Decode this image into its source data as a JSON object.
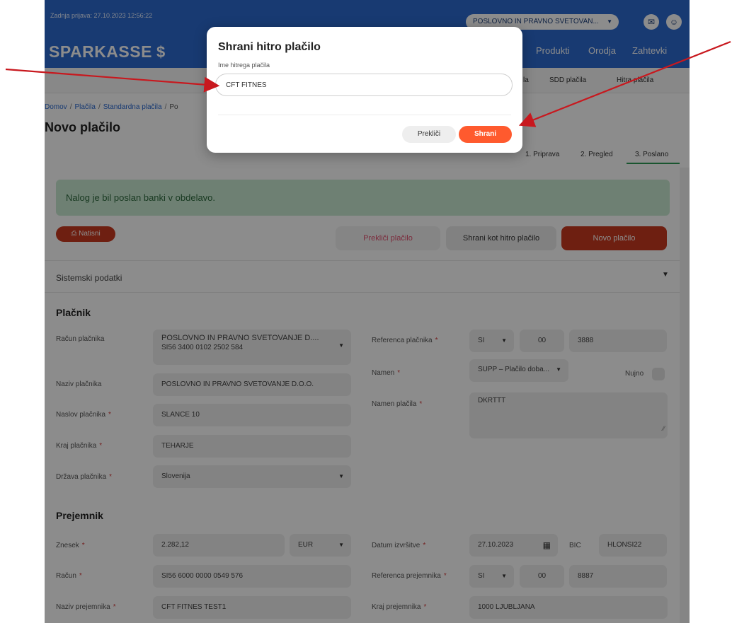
{
  "header": {
    "last_login": "Zadnja prijava: 27.10.2023 12:56:22",
    "company_select": "POSLOVNO IN PRAVNO SVETOVAN...",
    "logo": "SPARKASSE",
    "nav": [
      "Produkti",
      "Orodja",
      "Zahtevki"
    ],
    "subnav": [
      "la",
      "SDD plačila",
      "Hitra plačila"
    ]
  },
  "breadcrumb": [
    "Domov",
    "Plačila",
    "Standardna plačila",
    "Po"
  ],
  "page_title": "Novo plačilo",
  "steps": [
    "1. Priprava",
    "2. Pregled",
    "3. Poslano"
  ],
  "success_message": "Nalog je bil poslan banki v obdelavo.",
  "actions": {
    "print": "Natisni",
    "cancel_payment": "Prekliči plačilo",
    "save_fast": "Shrani kot hitro plačilo",
    "new_payment": "Novo plačilo"
  },
  "system_data_label": "Sistemski podatki",
  "payer": {
    "section_title": "Plačnik",
    "account_label": "Račun plačnika",
    "account_name": "POSLOVNO IN PRAVNO SVETOVANJE D....",
    "account_iban": "SI56 3400 0102 2502 584",
    "name_label": "Naziv plačnika",
    "name_value": "POSLOVNO IN PRAVNO SVETOVANJE D.O.O.",
    "address_label": "Naslov plačnika",
    "address_value": "SLANCE 10",
    "city_label": "Kraj plačnika",
    "city_value": "TEHARJE",
    "country_label": "Država plačnika",
    "country_value": "Slovenija",
    "reference_label": "Referenca plačnika",
    "reference_country": "SI",
    "reference_model": "00",
    "reference_number": "3888",
    "purpose_label": "Namen",
    "purpose_value": "SUPP – Plačilo doba...",
    "urgent_label": "Nujno",
    "payment_purpose_label": "Namen plačila",
    "payment_purpose_value": "DKRTTT"
  },
  "recipient": {
    "section_title": "Prejemnik",
    "amount_label": "Znesek",
    "amount_value": "2.282,12",
    "currency_value": "EUR",
    "account_label": "Račun",
    "account_value": "SI56 6000 0000 0549 576",
    "name_label": "Naziv prejemnika",
    "name_value": "CFT FITNES TEST1",
    "execution_date_label": "Datum izvršitve",
    "execution_date_value": "27.10.2023",
    "bic_label": "BIC",
    "bic_value": "HLONSI22",
    "reference_label": "Referenca prejemnika",
    "reference_country": "SI",
    "reference_model": "00",
    "reference_number": "8887",
    "city_label": "Kraj prejemnika",
    "city_value": "1000 LJUBLJANA"
  },
  "modal": {
    "title": "Shrani hitro plačilo",
    "field_label": "Ime hitrega plačila",
    "field_value": "CFT FITNES",
    "cancel": "Prekliči",
    "save": "Shrani"
  },
  "colors": {
    "header_blue": "#2c6ad0",
    "primary_red": "#c93a1f",
    "save_orange": "#ff5a2e",
    "success_bg": "#c9ead2",
    "step_active": "#2e9b57",
    "arrow_red": "#c8181e"
  }
}
